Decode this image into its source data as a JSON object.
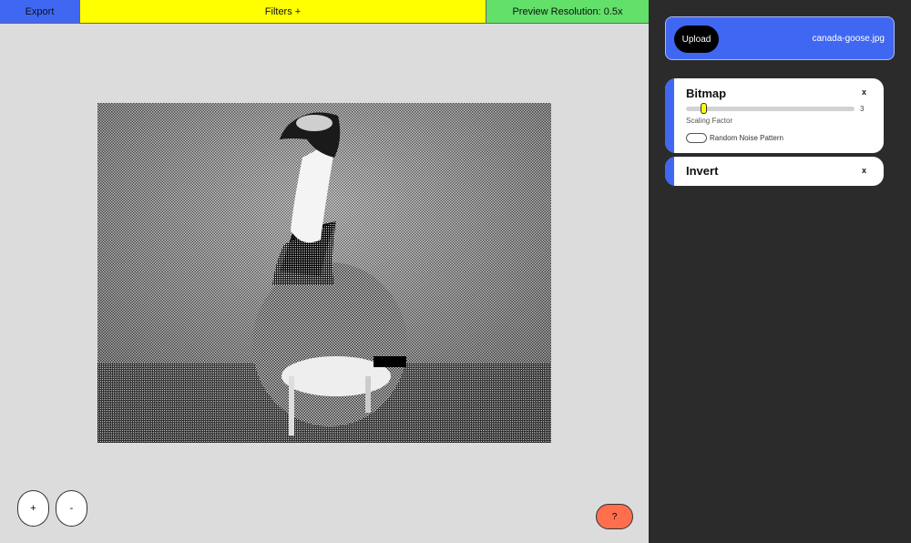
{
  "toolbar": {
    "export_label": "Export",
    "filters_label": "Filters +",
    "preview_resolution_label": "Preview Resolution: 0.5x"
  },
  "canvas": {
    "image_description_icon": "goose-photo-preview",
    "zoom_in_label": "+",
    "zoom_out_label": "-",
    "help_label": "?"
  },
  "sidebar": {
    "upload_label": "Upload",
    "file_name": "canada-goose.jpg",
    "filters": [
      {
        "title": "Bitmap",
        "close_label": "x",
        "slider": {
          "label": "Scaling Factor",
          "value": "3",
          "fraction": 0.1
        },
        "toggle": {
          "label": "Random Noise Pattern",
          "checked": false
        }
      },
      {
        "title": "Invert",
        "close_label": "x"
      }
    ]
  },
  "colors": {
    "export": "#3f67f2",
    "filters": "#ffff00",
    "preview": "#62e06a",
    "help": "#ff6e4d",
    "panel": "#2b2b2b",
    "accent": "#3f67f2"
  }
}
